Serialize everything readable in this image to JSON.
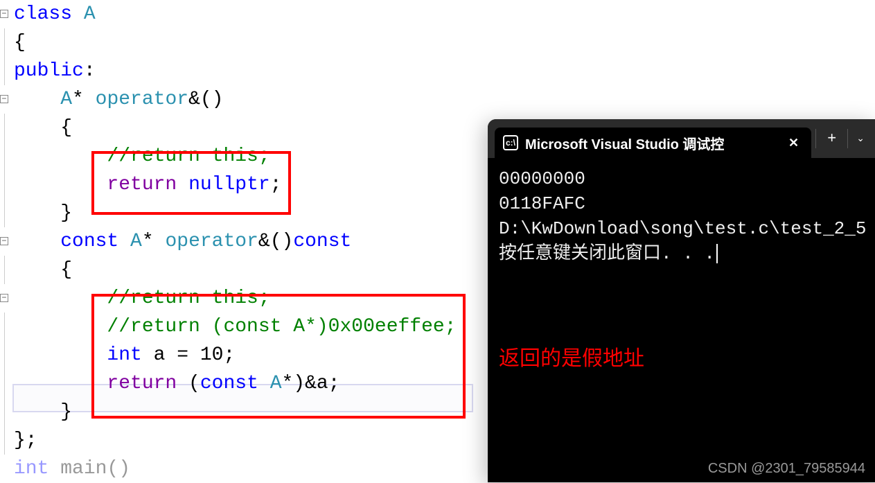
{
  "code": {
    "l1_kw": "class",
    "l1_name": " A",
    "l2": "{",
    "l3_kw": "public",
    "l3_colon": ":",
    "l4_pre": "    ",
    "l4_type": "A",
    "l4_star": "*",
    "l4_op": " operator",
    "l4_after": "&()",
    "l5": "    {",
    "l6_pre": "        ",
    "l6_comment": "//return this;",
    "l7_pre": "        ",
    "l7_ret": "return",
    "l7_sp": " ",
    "l7_null": "nullptr",
    "l7_semi": ";",
    "l8": "    }",
    "l9_pre": "    ",
    "l9_const": "const",
    "l9_sp": " ",
    "l9_type": "A",
    "l9_star": "*",
    "l9_op": " operator",
    "l9_amp": "&()",
    "l9_const2": "const",
    "l10": "    {",
    "l11_pre": "        ",
    "l11_comment": "//return this;",
    "l12_pre": "        ",
    "l12_comment": "//return (const A*)0x00eeffee;",
    "l13_pre": "        ",
    "l13_int": "int",
    "l13_rest": " a = 10;",
    "l14_pre": "        ",
    "l14_ret": "return",
    "l14_sp": " (",
    "l14_const": "const",
    "l14_sp2": " ",
    "l14_type": "A",
    "l14_rest": "*)&a;",
    "l15": "    }",
    "l16": "};",
    "l17_int": "int",
    "l17_main": " main()"
  },
  "terminal": {
    "title": "Microsoft Visual Studio 调试控",
    "out1": "00000000",
    "out2": "0118FAFC",
    "out3": "",
    "out4": "D:\\KwDownload\\song\\test.c\\test_2_5",
    "out5": "按任意键关闭此窗口. . ."
  },
  "annotation": "返回的是假地址",
  "watermark": "CSDN @2301_79585944"
}
